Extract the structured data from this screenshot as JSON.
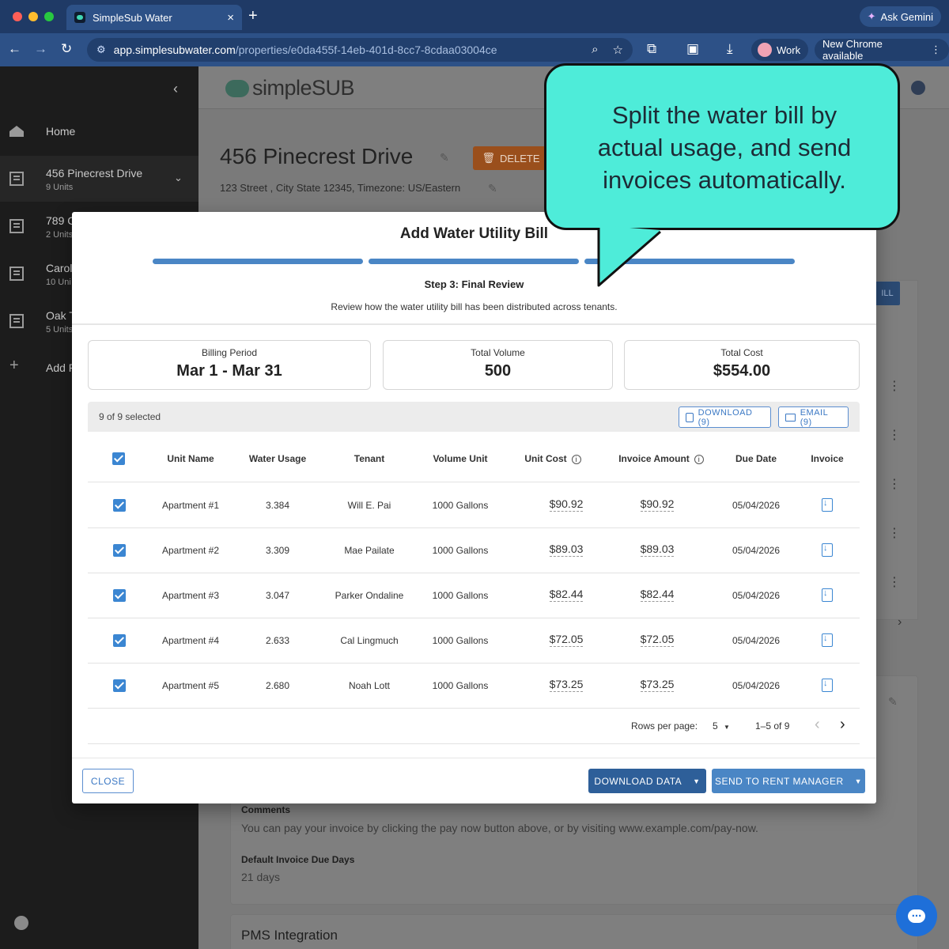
{
  "browser": {
    "tab_title": "SimpleSub Water",
    "tab_close": "×",
    "new_tab": "+",
    "ask_gemini": "Ask Gemini",
    "url_host": "app.simplesubwater.com",
    "url_path": "/properties/e0da455f-14eb-401d-8cc7-8cdaa03004ce",
    "profile": "Work",
    "update_notice": "New Chrome available",
    "more": "⋮"
  },
  "sidebar": {
    "collapse": "‹",
    "items": [
      {
        "name": "Home",
        "sub": ""
      },
      {
        "name": "456 Pinecrest Drive",
        "sub": "9 Units"
      },
      {
        "name": "789 C",
        "sub": "2 Units"
      },
      {
        "name": "Carol",
        "sub": "10 Uni"
      },
      {
        "name": "Oak T",
        "sub": "5 Units"
      },
      {
        "name": "Add P",
        "sub": ""
      }
    ],
    "expand_chevron": "⌄"
  },
  "page": {
    "logo_text": "simpleSUB",
    "title": "456 Pinecrest Drive",
    "delete_label": "DELETE",
    "address": "123 Street , City State 12345, Timezone: US/Eastern",
    "comments_label": "Comments",
    "comments_value": "You can pay your invoice by clicking the pay now button above, or by visiting www.example.com/pay-now.",
    "due_days_label": "Default Invoice Due Days",
    "due_days_value": "21 days",
    "pms_title": "PMS Integration",
    "bill_btn_fragment": "ILL"
  },
  "modal": {
    "title": "Add Water Utility Bill",
    "steps_total": 3,
    "step_current": 3,
    "step_title": "Step 3: Final Review",
    "step_subtitle": "Review how the water utility bill has been distributed across tenants.",
    "summary": [
      {
        "label": "Billing Period",
        "value": "Mar 1 - Mar 31"
      },
      {
        "label": "Total Volume",
        "value": "500"
      },
      {
        "label": "Total Cost",
        "value": "$554.00"
      }
    ],
    "selected_text": "9 of 9 selected",
    "download_btn": "DOWNLOAD (9)",
    "email_btn": "EMAIL (9)",
    "columns": [
      "Unit Name",
      "Water Usage",
      "Tenant",
      "Volume Unit",
      "Unit Cost",
      "Invoice Amount",
      "Due Date",
      "Invoice"
    ],
    "rows": [
      {
        "unit": "Apartment #1",
        "usage": "3.384",
        "tenant": "Will E. Pai",
        "vol_unit": "1000 Gallons",
        "unit_cost": "$90.92",
        "amount": "$90.92",
        "due": "05/04/2026"
      },
      {
        "unit": "Apartment #2",
        "usage": "3.309",
        "tenant": "Mae Pailate",
        "vol_unit": "1000 Gallons",
        "unit_cost": "$89.03",
        "amount": "$89.03",
        "due": "05/04/2026"
      },
      {
        "unit": "Apartment #3",
        "usage": "3.047",
        "tenant": "Parker Ondaline",
        "vol_unit": "1000 Gallons",
        "unit_cost": "$82.44",
        "amount": "$82.44",
        "due": "05/04/2026"
      },
      {
        "unit": "Apartment #4",
        "usage": "2.633",
        "tenant": "Cal Lingmuch",
        "vol_unit": "1000 Gallons",
        "unit_cost": "$72.05",
        "amount": "$72.05",
        "due": "05/04/2026"
      },
      {
        "unit": "Apartment #5",
        "usage": "2.680",
        "tenant": "Noah Lott",
        "vol_unit": "1000 Gallons",
        "unit_cost": "$73.25",
        "amount": "$73.25",
        "due": "05/04/2026"
      }
    ],
    "rows_per_page_label": "Rows per page:",
    "rows_per_page_value": "5",
    "page_range": "1–5 of 9",
    "prev": "‹",
    "next": "›",
    "close_btn": "CLOSE",
    "download_data_btn": "DOWNLOAD DATA",
    "send_btn": "SEND TO RENT MANAGER",
    "caret": "▼"
  },
  "callout": {
    "lines": [
      "Split the water bill by",
      "actual usage, and send",
      "invoices automatically."
    ]
  },
  "colors": {
    "accent": "#3b86d2",
    "callout": "#4eecd9",
    "primary_dark": "#2e5f99",
    "primary": "#4a86c5"
  }
}
